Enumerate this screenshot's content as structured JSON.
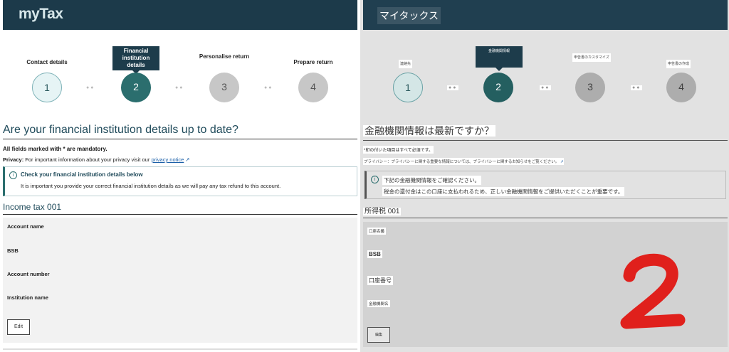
{
  "left": {
    "logo": "myTax",
    "steps": [
      {
        "label": "Contact details",
        "number": "1"
      },
      {
        "label": "",
        "number": "2"
      },
      {
        "label": "Personalise return",
        "number": "3"
      },
      {
        "label": "Prepare return",
        "number": "4"
      }
    ],
    "active_tooltip": "Financial institution details",
    "page_title": "Are your financial institution details up to date?",
    "mandatory_note": "All fields marked with * are mandatory.",
    "privacy": {
      "label": "Privacy:",
      "text": "For important information about your privacy visit our",
      "link": "privacy notice"
    },
    "info": {
      "icon": "i",
      "title": "Check your financial institution details below",
      "body": "It is important you provide your correct financial institution details as we will pay any tax refund to this account."
    },
    "section_title": "Income tax 001",
    "fields": [
      "Account name",
      "BSB",
      "Account number",
      "Institution name"
    ],
    "edit_label": "Edit"
  },
  "right": {
    "logo": "マイタックス",
    "steps": [
      {
        "label": "連絡先",
        "number": "1"
      },
      {
        "label": "",
        "number": "2"
      },
      {
        "label": "申告書のカスタマイズ",
        "number": "3"
      },
      {
        "label": "申告書の作成",
        "number": "4"
      }
    ],
    "active_tooltip": "金融機関情報",
    "page_title": "金融機関情報は最新ですか？",
    "mandatory_note": "*印の付いた項目はすべて必須です。",
    "privacy": {
      "text": "プライバシー：プライバシーに関する重要な情報については、プライバシーに関するお知らせをご覧ください。"
    },
    "info": {
      "icon": "i",
      "title": "下記の金融機関情報をご確認ください。",
      "body": "税金の還付金はこの口座に支払われるため、正しい金融機関情報をご提供いただくことが重要です。"
    },
    "section_title": "所得税 001",
    "fields": [
      "口座名義",
      "BSB",
      "口座番号",
      "金融機関名"
    ],
    "edit_label": "編集"
  },
  "colors": {
    "header": "#1c3a4a",
    "accent": "#2b6e6e",
    "stamp": "#e0201c"
  }
}
